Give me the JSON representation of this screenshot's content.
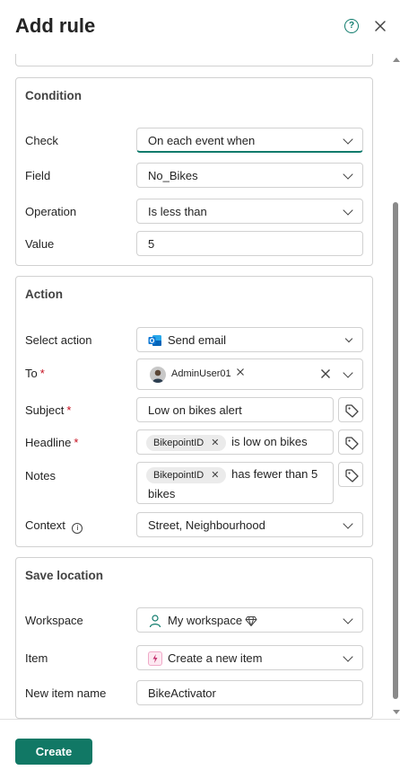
{
  "panel": {
    "title": "Add rule"
  },
  "condition": {
    "title": "Condition",
    "check": {
      "label": "Check",
      "value": "On each event when"
    },
    "field": {
      "label": "Field",
      "value": "No_Bikes"
    },
    "operation": {
      "label": "Operation",
      "value": "Is less than"
    },
    "value": {
      "label": "Value",
      "value": "5"
    }
  },
  "action": {
    "title": "Action",
    "select_action": {
      "label": "Select action",
      "value": "Send email",
      "icon": "outlook-icon"
    },
    "to": {
      "label": "To",
      "required": "*",
      "recipient": "AdminUser01"
    },
    "subject": {
      "label": "Subject",
      "required": "*",
      "value": "Low on bikes alert"
    },
    "headline": {
      "label": "Headline",
      "required": "*",
      "chip": "BikepointID",
      "text": "is low on bikes"
    },
    "notes": {
      "label": "Notes",
      "chip": "BikepointID",
      "text_line1": "has fewer than 5",
      "text_line2": "bikes"
    },
    "context": {
      "label": "Context",
      "value": "Street, Neighbourhood"
    }
  },
  "save_location": {
    "title": "Save location",
    "workspace": {
      "label": "Workspace",
      "value": "My workspace"
    },
    "item": {
      "label": "Item",
      "value": "Create a new item"
    },
    "new_item_name": {
      "label": "New item name",
      "value": "BikeActivator"
    }
  },
  "footer": {
    "create_label": "Create"
  },
  "colors": {
    "accent": "#117865",
    "required": "#c50f1f",
    "border": "#d1d1d1"
  }
}
